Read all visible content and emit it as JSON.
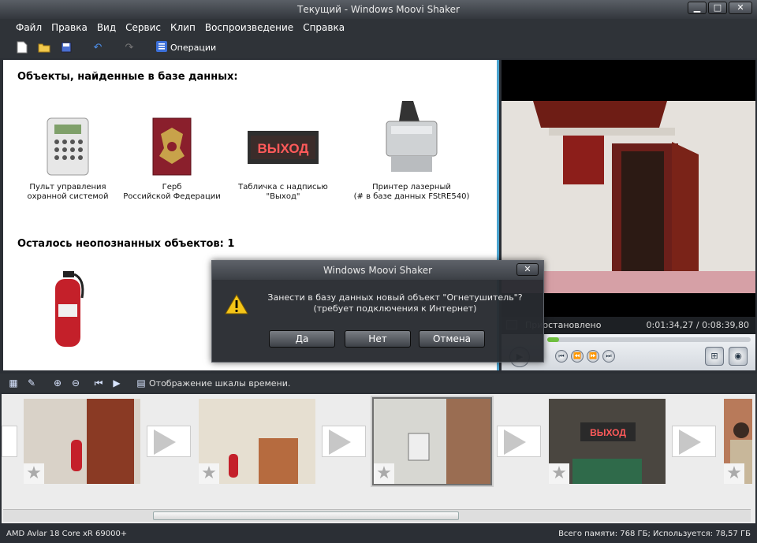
{
  "window": {
    "title": "Текущий - Windows Moovi  Shaker"
  },
  "menu": [
    "Файл",
    "Правка",
    "Вид",
    "Сервис",
    "Клип",
    "Воспроизведение",
    "Справка"
  ],
  "toolbar": {
    "operations_label": "Операции"
  },
  "objects": {
    "found_heading": "Объекты, найденные в базе данных:",
    "items": [
      {
        "label_line1": "Пульт управления",
        "label_line2": "охранной системой"
      },
      {
        "label_line1": "Герб",
        "label_line2": "Российской Федерации"
      },
      {
        "label_line1": "Табличка с надписью",
        "label_line2": "\"Выход\""
      },
      {
        "label_line1": "Принтер лазерный",
        "label_line2": "(# в базе данных FStRE540)"
      }
    ],
    "unrecognized_heading": "Осталось неопознанных объектов: 1",
    "sign_text": "ВЫХОД"
  },
  "player": {
    "status": "Приостановлено",
    "time": "0:01:34,27 / 0:08:39,80",
    "progress": 0.05
  },
  "timeline_toolbar": {
    "label": "Отображение шкалы времени."
  },
  "timeline": {
    "frame_sign_text": "ВЫХОД"
  },
  "statusbar": {
    "left": "AMD Avlar 18 Core xR 69000+",
    "right": "Всего памяти: 768 ГБ; Используется: 78,57 ГБ"
  },
  "dialog": {
    "title": "Windows Moovi Shaker",
    "message_line1": "Занести в базу данных новый объект \"Огнетушитель\"?",
    "message_line2": "(требует подключения к Интернет)",
    "yes": "Да",
    "no": "Нет",
    "cancel": "Отмена"
  }
}
